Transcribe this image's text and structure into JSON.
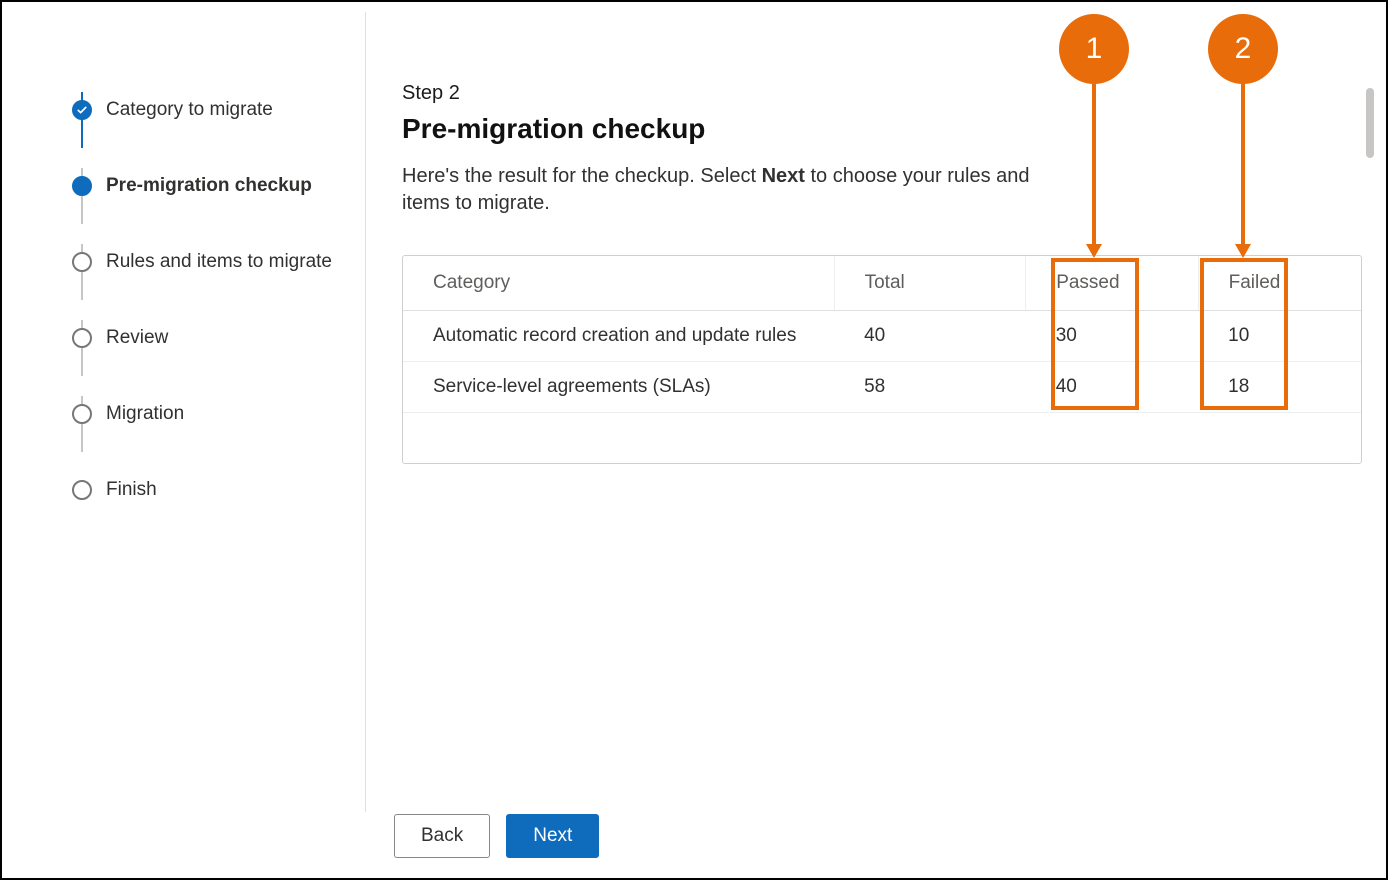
{
  "sidebar": {
    "steps": [
      {
        "label": "Category to migrate",
        "state": "done"
      },
      {
        "label": "Pre-migration checkup",
        "state": "current"
      },
      {
        "label": "Rules and items to migrate",
        "state": "upcoming"
      },
      {
        "label": "Review",
        "state": "upcoming"
      },
      {
        "label": "Migration",
        "state": "upcoming"
      },
      {
        "label": "Finish",
        "state": "upcoming"
      }
    ]
  },
  "main": {
    "step_label": "Step 2",
    "title": "Pre-migration checkup",
    "desc_prefix": "Here's the result for the checkup. Select ",
    "desc_bold": "Next",
    "desc_suffix": " to choose your rules and items to migrate.",
    "table": {
      "columns": {
        "category": "Category",
        "total": "Total",
        "passed": "Passed",
        "failed": "Failed"
      },
      "rows": [
        {
          "category": "Automatic record creation and update rules",
          "total": "40",
          "passed": "30",
          "failed": "10"
        },
        {
          "category": "Service-level agreements (SLAs)",
          "total": "58",
          "passed": "40",
          "failed": "18"
        }
      ]
    }
  },
  "callouts": {
    "one": "1",
    "two": "2"
  },
  "footer": {
    "back": "Back",
    "next": "Next"
  }
}
